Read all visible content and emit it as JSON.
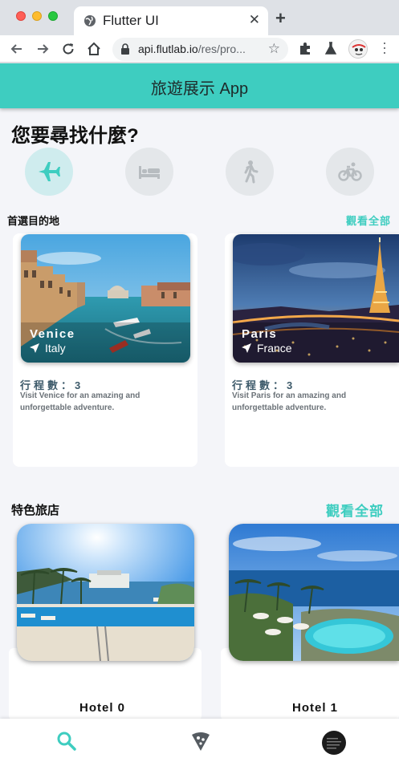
{
  "browser": {
    "tab_title": "Flutter UI",
    "url_host": "api.flutlab.io",
    "url_path": "/res/pro..."
  },
  "app": {
    "title": "旅遊展示 App",
    "question": "您要尋找什麼?",
    "categories": [
      {
        "icon": "airplane-icon",
        "active": true
      },
      {
        "icon": "bed-icon",
        "active": false
      },
      {
        "icon": "walking-icon",
        "active": false
      },
      {
        "icon": "bicycle-icon",
        "active": false
      }
    ],
    "destinations_section": {
      "title": "首選目的地",
      "see_all": "觀看全部"
    },
    "destinations": [
      {
        "city": "Venice",
        "country": "Italy",
        "activities_label": "行程數：3",
        "description": "Visit Venice for an amazing and unforgettable adventure."
      },
      {
        "city": "Paris",
        "country": "France",
        "activities_label": "行程數：3",
        "description": "Visit Paris for an amazing and unforgettable adventure."
      }
    ],
    "hotels_section": {
      "title": "特色旅店",
      "see_all": "觀看全部"
    },
    "hotels": [
      {
        "name": "Hotel 0"
      },
      {
        "name": "Hotel 1"
      }
    ],
    "bottom_nav": [
      {
        "icon": "search-icon",
        "active": true
      },
      {
        "icon": "pizza-icon",
        "active": false
      },
      {
        "icon": "profile-avatar",
        "active": false
      }
    ],
    "colors": {
      "accent": "#3ecdc0",
      "background": "#f4f5f9",
      "count_text": "#3d5a6a"
    }
  }
}
